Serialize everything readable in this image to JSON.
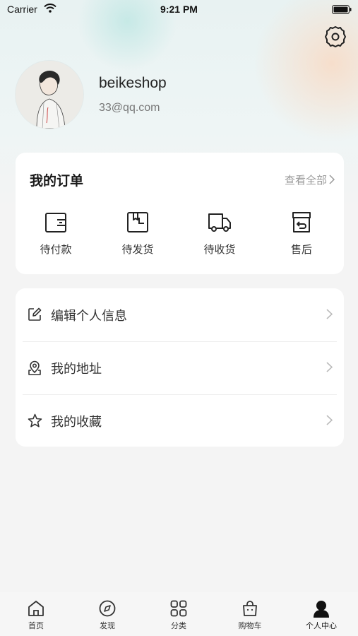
{
  "status_bar": {
    "carrier": "Carrier",
    "time": "9:21 PM"
  },
  "icons": {
    "settings": "gear-icon"
  },
  "profile": {
    "username": "beikeshop",
    "email": "33@qq.com"
  },
  "orders": {
    "title": "我的订单",
    "view_all": "查看全部",
    "items": [
      {
        "label": "待付款",
        "icon": "wallet-icon"
      },
      {
        "label": "待发货",
        "icon": "package-icon"
      },
      {
        "label": "待收货",
        "icon": "truck-icon"
      },
      {
        "label": "售后",
        "icon": "return-box-icon"
      }
    ]
  },
  "menu": {
    "items": [
      {
        "label": "编辑个人信息",
        "icon": "edit-icon"
      },
      {
        "label": "我的地址",
        "icon": "location-icon"
      },
      {
        "label": "我的收藏",
        "icon": "star-icon"
      }
    ]
  },
  "tabbar": {
    "items": [
      {
        "label": "首页",
        "icon": "home-icon"
      },
      {
        "label": "发现",
        "icon": "compass-icon"
      },
      {
        "label": "分类",
        "icon": "grid-icon"
      },
      {
        "label": "购物车",
        "icon": "cart-icon"
      },
      {
        "label": "个人中心",
        "icon": "user-icon"
      }
    ],
    "active": "个人中心"
  }
}
